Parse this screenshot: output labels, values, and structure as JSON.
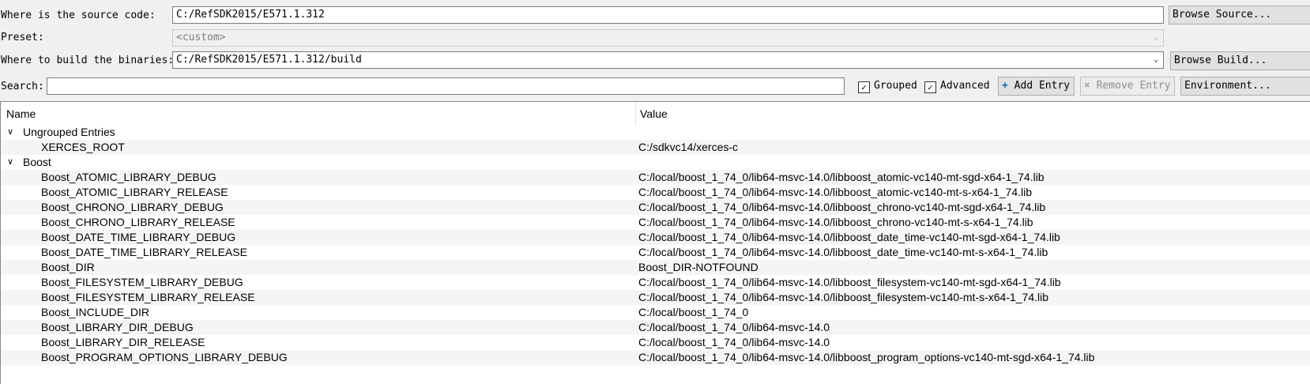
{
  "source": {
    "label": "Where is the source code:",
    "value": "C:/RefSDK2015/E571.1.312",
    "browse_label": "Browse Source..."
  },
  "preset": {
    "label": "Preset:",
    "value": "<custom>"
  },
  "build": {
    "label": "Where to build the binaries:",
    "value": "C:/RefSDK2015/E571.1.312/build",
    "browse_label": "Browse Build..."
  },
  "search": {
    "label": "Search:",
    "value": ""
  },
  "toolbar": {
    "grouped_label": "Grouped",
    "grouped_checked": true,
    "advanced_label": "Advanced",
    "advanced_checked": true,
    "add_entry_label": "Add Entry",
    "remove_entry_label": "Remove Entry",
    "environment_label": "Environment..."
  },
  "table": {
    "headers": {
      "name": "Name",
      "value": "Value"
    },
    "groups": [
      {
        "name": "Ungrouped Entries",
        "entries": [
          {
            "name": "XERCES_ROOT",
            "value": "C:/sdkvc14/xerces-c"
          }
        ]
      },
      {
        "name": "Boost",
        "entries": [
          {
            "name": "Boost_ATOMIC_LIBRARY_DEBUG",
            "value": "C:/local/boost_1_74_0/lib64-msvc-14.0/libboost_atomic-vc140-mt-sgd-x64-1_74.lib"
          },
          {
            "name": "Boost_ATOMIC_LIBRARY_RELEASE",
            "value": "C:/local/boost_1_74_0/lib64-msvc-14.0/libboost_atomic-vc140-mt-s-x64-1_74.lib"
          },
          {
            "name": "Boost_CHRONO_LIBRARY_DEBUG",
            "value": "C:/local/boost_1_74_0/lib64-msvc-14.0/libboost_chrono-vc140-mt-sgd-x64-1_74.lib"
          },
          {
            "name": "Boost_CHRONO_LIBRARY_RELEASE",
            "value": "C:/local/boost_1_74_0/lib64-msvc-14.0/libboost_chrono-vc140-mt-s-x64-1_74.lib"
          },
          {
            "name": "Boost_DATE_TIME_LIBRARY_DEBUG",
            "value": "C:/local/boost_1_74_0/lib64-msvc-14.0/libboost_date_time-vc140-mt-sgd-x64-1_74.lib"
          },
          {
            "name": "Boost_DATE_TIME_LIBRARY_RELEASE",
            "value": "C:/local/boost_1_74_0/lib64-msvc-14.0/libboost_date_time-vc140-mt-s-x64-1_74.lib"
          },
          {
            "name": "Boost_DIR",
            "value": "Boost_DIR-NOTFOUND"
          },
          {
            "name": "Boost_FILESYSTEM_LIBRARY_DEBUG",
            "value": "C:/local/boost_1_74_0/lib64-msvc-14.0/libboost_filesystem-vc140-mt-sgd-x64-1_74.lib"
          },
          {
            "name": "Boost_FILESYSTEM_LIBRARY_RELEASE",
            "value": "C:/local/boost_1_74_0/lib64-msvc-14.0/libboost_filesystem-vc140-mt-s-x64-1_74.lib"
          },
          {
            "name": "Boost_INCLUDE_DIR",
            "value": "C:/local/boost_1_74_0"
          },
          {
            "name": "Boost_LIBRARY_DIR_DEBUG",
            "value": "C:/local/boost_1_74_0/lib64-msvc-14.0"
          },
          {
            "name": "Boost_LIBRARY_DIR_RELEASE",
            "value": "C:/local/boost_1_74_0/lib64-msvc-14.0"
          },
          {
            "name": "Boost_PROGRAM_OPTIONS_LIBRARY_DEBUG",
            "value": "C:/local/boost_1_74_0/lib64-msvc-14.0/libboost_program_options-vc140-mt-sgd-x64-1_74.lib"
          }
        ]
      }
    ]
  }
}
